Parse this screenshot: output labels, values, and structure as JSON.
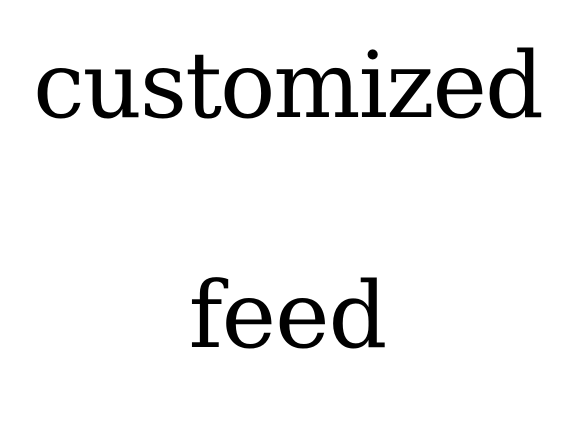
{
  "text": {
    "line1": "customized",
    "line2": "feed"
  },
  "colors": {
    "background": "#ffffff",
    "text": "#000000"
  }
}
